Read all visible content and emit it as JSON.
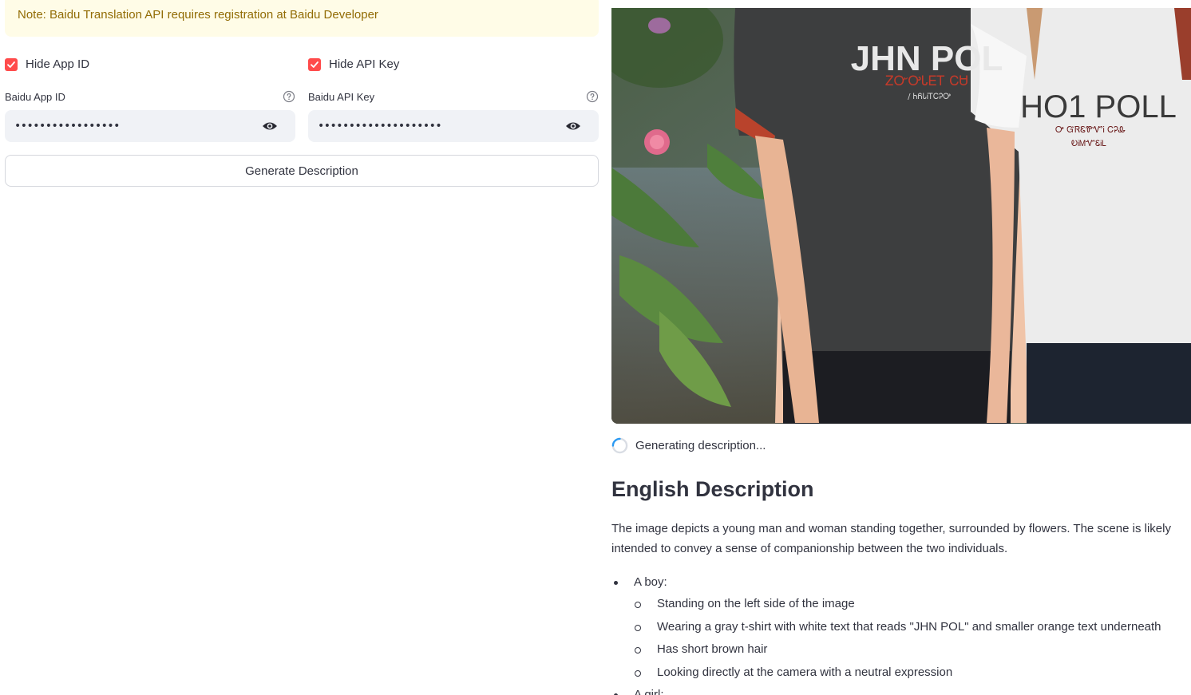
{
  "note": {
    "text": "Note: Baidu Translation API requires registration at Baidu Developer"
  },
  "checkboxes": [
    {
      "label": "Hide App ID",
      "checked": true
    },
    {
      "label": "Hide API Key",
      "checked": true
    }
  ],
  "fields": [
    {
      "label": "Baidu App ID",
      "value": "•••••••••••••••••"
    },
    {
      "label": "Baidu API Key",
      "value": "••••••••••••••••••••"
    }
  ],
  "generate_button": {
    "label": "Generate Description"
  },
  "status": {
    "text": "Generating description..."
  },
  "description": {
    "title": "English Description",
    "text": "The image depicts a young man and woman standing together, surrounded by flowers. The scene is likely intended to convey a sense of companionship between the two individuals.",
    "bullet_1": "A boy:",
    "sub_bullets": [
      "Standing on the left side of the image",
      "Wearing a gray t-shirt with white text that reads \"JHN POL\" and smaller orange text underneath",
      "Has short brown hair",
      "Looking directly at the camera with a neutral expression"
    ],
    "bullet_2": "A girl:"
  },
  "image": {
    "shirt_left_text": "JHN POL",
    "shirt_left_subtext": "ᏃᏅᎤᏓᎬᎢ ᏟᏌ",
    "shirt_left_small": "/ ᏂᏲᏓᎥᎢᏟᎮᎤ",
    "shirt_right_text": "HO1 POLL",
    "shirt_right_sub1": "Ꭴ ᏳᏒᏋᏈᏉᎥ ᏟᎮᎲ",
    "shirt_right_sub2": "ᎧᎥᎷᏉᏋᎥᏞ"
  },
  "colors": {
    "accent": "#ff4b4b",
    "note_bg": "#fffce7",
    "note_text": "#926c05",
    "input_bg": "#f0f2f6"
  }
}
